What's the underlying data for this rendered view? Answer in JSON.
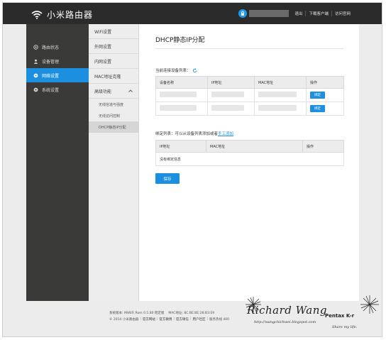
{
  "header": {
    "brand": "小米路由器",
    "links": [
      "退出",
      "下载客户端",
      "访问官网"
    ]
  },
  "sidebar": {
    "items": [
      {
        "label": "路由状态",
        "icon": "status-icon",
        "active": false
      },
      {
        "label": "设备管理",
        "icon": "user-icon",
        "active": false
      },
      {
        "label": "网络设置",
        "icon": "gear-icon",
        "active": true
      },
      {
        "label": "系统设置",
        "icon": "gear-icon",
        "active": false
      }
    ]
  },
  "submenu": {
    "items": [
      "WiFi设置",
      "外网设置",
      "内网设置",
      "MAC地址克隆"
    ],
    "group": {
      "label": "高级功能",
      "children": [
        "无线信道与强度",
        "无线访问控制",
        "DHCP静态IP分配"
      ],
      "active_child": "DHCP静态IP分配"
    }
  },
  "main": {
    "title": "DHCP静态IP分配",
    "connected_label": "当前连接设备列表：",
    "connected_columns": [
      "设备名称",
      "IP地址",
      "MAC地址",
      "操作"
    ],
    "connected_rows": [
      {
        "action": "绑定"
      },
      {
        "action": "绑定"
      }
    ],
    "bound_label": "绑定列表：可以从设备列表添加或者",
    "bound_link": "手工添加",
    "bound_columns": [
      "IP地址",
      "MAC地址",
      "操作"
    ],
    "bound_empty": "没有绑定信息",
    "save_label": "保存"
  },
  "footer": {
    "line1_a": "系统版本: MiWiFi Rom 0.5.80 稳定版",
    "line1_b": "MAC地址: 8C:BE:BE:28:B3:E9",
    "line2_copyright": "© 2014 小米路由器",
    "line2_links": [
      "官方网站",
      "官方微博",
      "官方微信",
      "用户社区"
    ],
    "line2_tail": "服务热线 400"
  },
  "watermark": {
    "name": "Richard Wang",
    "url": "http://wangchichwei.blogspot.com",
    "camera": "Pentax K-r",
    "tagline": "Share my life."
  },
  "colors": {
    "accent": "#1d8fe1",
    "topbar": "#2b2b2b",
    "sidebar": "#3a3a38"
  }
}
